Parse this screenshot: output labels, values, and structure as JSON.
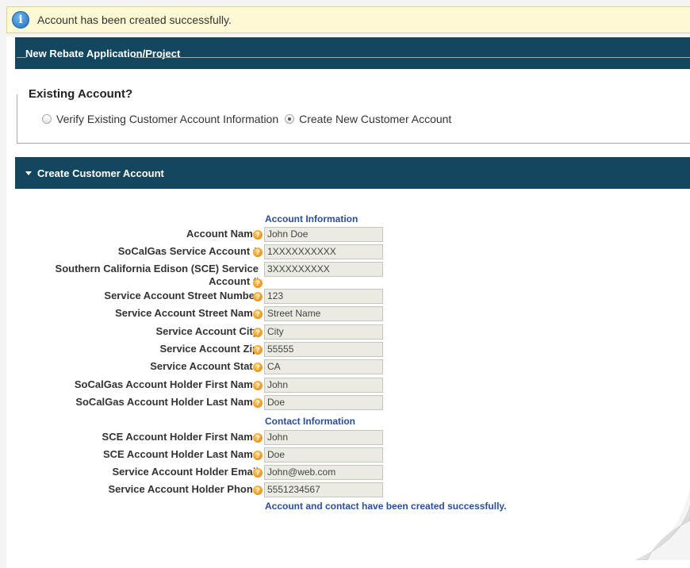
{
  "notice": {
    "text": "Account has been created successfully.",
    "icon": "info-icon"
  },
  "header": {
    "title": "New Rebate Application/Project"
  },
  "existing_account": {
    "legend": "Existing Account?",
    "options": [
      {
        "label": "Verify Existing Customer Account Information",
        "selected": false
      },
      {
        "label": "Create New Customer Account",
        "selected": true
      }
    ]
  },
  "create_section": {
    "title": "Create Customer Account"
  },
  "account_info": {
    "heading": "Account Information",
    "fields": [
      {
        "label": "Account Name",
        "value": "John Doe"
      },
      {
        "label": "SoCalGas Service Account #",
        "value": "1XXXXXXXXXX"
      },
      {
        "label": "Southern California Edison (SCE) Service Account #",
        "value": "3XXXXXXXXX"
      },
      {
        "label": "Service Account Street Number",
        "value": "123"
      },
      {
        "label": "Service Account Street Name",
        "value": "Street Name"
      },
      {
        "label": "Service Account City",
        "value": "City"
      },
      {
        "label": "Service Account Zip",
        "value": "55555"
      },
      {
        "label": "Service Account State",
        "value": "CA"
      },
      {
        "label": "SoCalGas Account Holder First Name",
        "value": "John"
      },
      {
        "label": "SoCalGas Account Holder Last Name",
        "value": "Doe"
      }
    ]
  },
  "contact_info": {
    "heading": "Contact Information",
    "fields": [
      {
        "label": "SCE Account Holder First Name",
        "value": "John"
      },
      {
        "label": "SCE Account Holder Last Name",
        "value": "Doe"
      },
      {
        "label": "Service Account Holder Email",
        "value": "John@web.com"
      },
      {
        "label": "Service Account Holder Phone",
        "value": "5551234567"
      }
    ]
  },
  "success_message": "Account and contact have been created successfully."
}
